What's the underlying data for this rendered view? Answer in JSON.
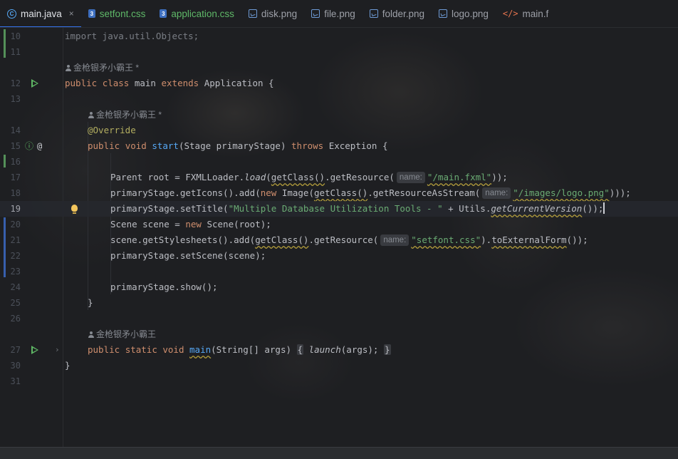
{
  "tabs": [
    {
      "label": "main.java",
      "icon": "java-class-icon",
      "active": true
    },
    {
      "label": "setfont.css",
      "icon": "css-file-icon"
    },
    {
      "label": "application.css",
      "icon": "css-file-icon"
    },
    {
      "label": "disk.png",
      "icon": "image-file-icon"
    },
    {
      "label": "file.png",
      "icon": "image-file-icon"
    },
    {
      "label": "folder.png",
      "icon": "image-file-icon"
    },
    {
      "label": "logo.png",
      "icon": "image-file-icon"
    },
    {
      "label": "main.f",
      "icon": "fxml-file-icon"
    }
  ],
  "tab_close_glyph": "×",
  "author": {
    "name": "金枪银矛小霸王",
    "suffix": "*"
  },
  "hints": {
    "name": "name:"
  },
  "line_numbers": {
    "l10": "10",
    "l11": "11",
    "l12": "12",
    "l13": "13",
    "l14": "14",
    "l15": "15",
    "l16": "16",
    "l17": "17",
    "l18": "18",
    "l19": "19",
    "l20": "20",
    "l21": "21",
    "l22": "22",
    "l23": "23",
    "l24": "24",
    "l25": "25",
    "l26": "26",
    "l27": "27",
    "l30": "30",
    "l31": "31"
  },
  "code": {
    "import_line": "import java.util.Objects;",
    "class_public": "public",
    "class_kw": "class",
    "class_name": "main",
    "extends_kw": "extends",
    "superclass": "Application {",
    "override": "@Override",
    "start_public": "public",
    "start_void": "void",
    "start_name": "start",
    "start_params": "(Stage primaryStage)",
    "throws_kw": "throws",
    "start_exception": "Exception {",
    "l17_a": "Parent root = FXMLLoader.",
    "l17_load": "load",
    "l17_b": "(",
    "l17_getclass": "getClass()",
    "l17_c": ".getResource(",
    "l17_str": "\"/main.fxml\"",
    "l17_d": "));",
    "l18_a": "primaryStage.getIcons().add(",
    "l18_new": "new",
    "l18_b": " Image(",
    "l18_getclass": "getClass()",
    "l18_c": ".getResourceAsStream(",
    "l18_str": "\"/images/logo.png\"",
    "l18_d": ")));",
    "l19_a": "primaryStage.setTitle(",
    "l19_str": "\"Multiple Database Utilization Tools - \"",
    "l19_b": " + Utils.",
    "l19_call": "getCurrentVersion",
    "l19_c": "());",
    "l20_a": "Scene scene = ",
    "l20_new": "new",
    "l20_b": " Scene(root);",
    "l21_a": "scene.getStylesheets().add(",
    "l21_getclass": "getClass()",
    "l21_b": ".getResource(",
    "l21_str": "\"setfont.css\"",
    "l21_c": ").",
    "l21_ext": "toExternalForm",
    "l21_d": "());",
    "l22": "primaryStage.setScene(scene);",
    "l24": "primaryStage.show();",
    "l25": "}",
    "main_public": "public",
    "main_static": "static",
    "main_void": "void",
    "main_name": "main",
    "main_params": "(String[] args)",
    "main_open": "{",
    "main_launch": "launch",
    "main_body": "(args);",
    "main_close": "}",
    "l30": "}"
  },
  "colors": {
    "keyword": "#cf8e6d",
    "string": "#6aab73",
    "function": "#56a8f5",
    "annotation": "#b3ae60",
    "accent": "#3574f0"
  }
}
